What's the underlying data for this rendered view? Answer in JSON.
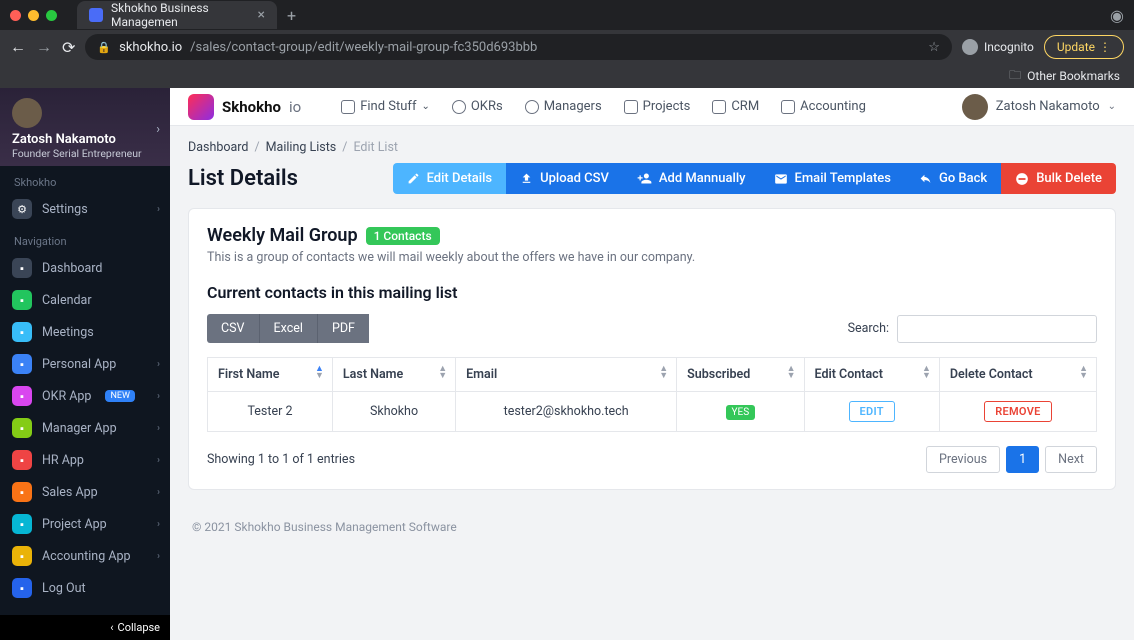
{
  "browser": {
    "tab_title": "Skhokho Business Managemen",
    "url_host": "skhokho.io",
    "url_path": "/sales/contact-group/edit/weekly-mail-group-fc350d693bbb",
    "incognito_label": "Incognito",
    "update_label": "Update",
    "other_bookmarks": "Other Bookmarks"
  },
  "topbar": {
    "brand": "Skhokho",
    "brand_suffix": "io",
    "nav": [
      {
        "label": "Find Stuff"
      },
      {
        "label": "OKRs"
      },
      {
        "label": "Managers"
      },
      {
        "label": "Projects"
      },
      {
        "label": "CRM"
      },
      {
        "label": "Accounting"
      }
    ],
    "user": "Zatosh Nakamoto"
  },
  "sidebar": {
    "user_name": "Zatosh Nakamoto",
    "user_title": "Founder Serial Entrepreneur",
    "section_a": "Skhokho",
    "settings_label": "Settings",
    "section_b": "Navigation",
    "items": [
      {
        "label": "Dashboard",
        "c": "#3a4556",
        "chev": false
      },
      {
        "label": "Calendar",
        "c": "#22c55e",
        "chev": false
      },
      {
        "label": "Meetings",
        "c": "#38bdf8",
        "chev": false
      },
      {
        "label": "Personal App",
        "c": "#3b82f6",
        "chev": true
      },
      {
        "label": "OKR App",
        "c": "#d946ef",
        "new": true,
        "chev": true
      },
      {
        "label": "Manager App",
        "c": "#84cc16",
        "chev": true
      },
      {
        "label": "HR App",
        "c": "#ef4444",
        "chev": true
      },
      {
        "label": "Sales App",
        "c": "#f97316",
        "chev": true
      },
      {
        "label": "Project App",
        "c": "#06b6d4",
        "chev": true
      },
      {
        "label": "Accounting App",
        "c": "#eab308",
        "chev": true
      },
      {
        "label": "Log Out",
        "c": "#2563eb",
        "chev": false
      }
    ],
    "new_badge": "NEW",
    "collapse": "Collapse"
  },
  "breadcrumb": {
    "a": "Dashboard",
    "b": "Mailing Lists",
    "c": "Edit List"
  },
  "page": {
    "title": "List Details",
    "actions": {
      "edit": "Edit Details",
      "upload": "Upload CSV",
      "add": "Add Mannually",
      "templates": "Email Templates",
      "back": "Go Back",
      "delete": "Bulk Delete"
    },
    "list_name": "Weekly Mail Group",
    "list_badge": "1 Contacts",
    "list_desc": "This is a group of contacts we will mail weekly about the offers we have in our company.",
    "subtitle": "Current contacts in this mailing list",
    "exports": {
      "csv": "CSV",
      "excel": "Excel",
      "pdf": "PDF"
    },
    "search_label": "Search:",
    "columns": {
      "first": "First Name",
      "last": "Last Name",
      "email": "Email",
      "sub": "Subscribed",
      "editc": "Edit Contact",
      "delc": "Delete Contact"
    },
    "rows": [
      {
        "first": "Tester 2",
        "last": "Skhokho",
        "email": "tester2@skhokho.tech",
        "sub": "YES"
      }
    ],
    "row_edit_label": "EDIT",
    "row_remove_label": "REMOVE",
    "showing": "Showing 1 to 1 of 1 entries",
    "pager": {
      "prev": "Previous",
      "page": "1",
      "next": "Next"
    }
  },
  "footer": "© 2021 Skhokho Business Management Software"
}
